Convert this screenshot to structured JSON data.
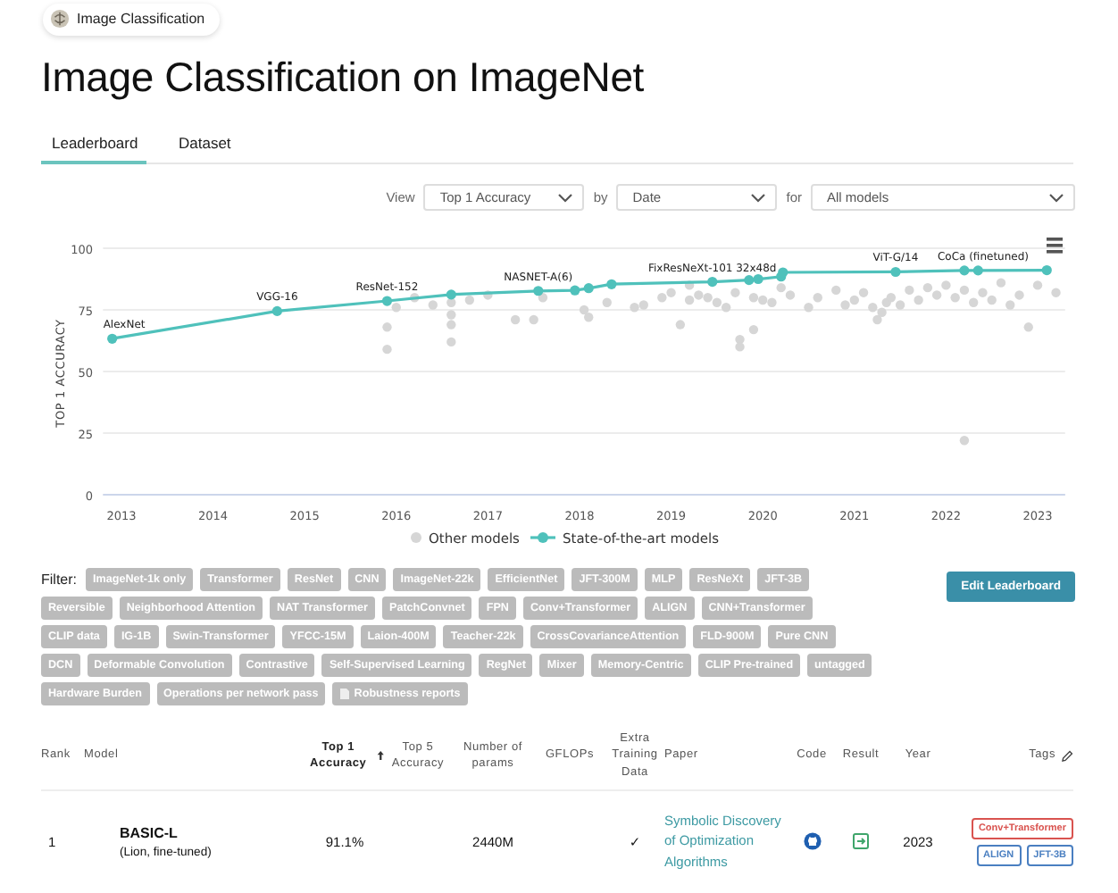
{
  "breadcrumb": {
    "label": "Image Classification"
  },
  "title": "Image Classification on ImageNet",
  "tabs": [
    {
      "label": "Leaderboard",
      "selected": true
    },
    {
      "label": "Dataset",
      "selected": false
    }
  ],
  "view_controls": [
    {
      "label": "View",
      "value": "Top 1 Accuracy"
    },
    {
      "label": "by",
      "value": "Date"
    },
    {
      "label": "for",
      "value": "All models"
    }
  ],
  "chart": {
    "chart_data": {
      "type": "line",
      "grid": true,
      "legend": true,
      "ylabel": "TOP 1 ACCURACY",
      "xlim": [
        2012.8,
        2023.3
      ],
      "ylim": [
        0,
        100
      ],
      "xticks": [
        2013,
        2014,
        2015,
        2016,
        2017,
        2018,
        2019,
        2020,
        2021,
        2022,
        2023
      ],
      "yticks": [
        0,
        25,
        50,
        75,
        100
      ],
      "series": [
        {
          "name": "Other models",
          "type": "scatter",
          "color": "#d6d6d6",
          "x": [
            2015.9,
            2015.9,
            2016.0,
            2016.2,
            2016.4,
            2016.6,
            2016.6,
            2016.6,
            2016.6,
            2016.8,
            2017.0,
            2017.3,
            2017.5,
            2017.6,
            2018.05,
            2018.1,
            2018.3,
            2018.6,
            2018.7,
            2018.9,
            2019.0,
            2019.1,
            2019.2,
            2019.3,
            2019.4,
            2019.5,
            2019.6,
            2019.7,
            2019.75,
            2019.75,
            2019.9,
            2019.9,
            2020.0,
            2020.1,
            2020.3,
            2020.5,
            2020.6,
            2020.8,
            2020.9,
            2021.0,
            2021.1,
            2021.2,
            2021.25,
            2021.3,
            2021.35,
            2021.4,
            2021.5,
            2021.6,
            2021.7,
            2021.8,
            2021.9,
            2022.0,
            2022.1,
            2022.2,
            2022.3,
            2022.4,
            2022.5,
            2022.6,
            2022.7,
            2022.8,
            2022.9,
            2023.0,
            2023.2,
            2022.2,
            2019.2,
            2020.2
          ],
          "values": [
            59,
            68,
            76,
            80,
            77,
            78,
            73,
            69,
            62,
            79,
            81,
            71,
            71,
            80,
            75,
            72,
            78,
            76,
            77,
            80,
            82,
            69,
            79,
            81,
            80,
            78,
            76,
            82,
            63,
            60,
            80,
            67,
            79,
            78,
            81,
            76,
            80,
            83,
            77,
            79,
            82,
            76,
            71,
            74,
            78,
            80,
            77,
            83,
            79,
            84,
            81,
            85,
            80,
            83,
            78,
            82,
            79,
            86,
            77,
            81,
            68,
            85,
            82,
            22,
            85,
            84
          ]
        },
        {
          "name": "State-of-the-art models",
          "type": "line",
          "marker": true,
          "color": "#4fc1bb",
          "x": [
            2012.9,
            2014.7,
            2015.9,
            2016.6,
            2017.55,
            2017.95,
            2018.1,
            2018.35,
            2019.45,
            2019.85,
            2019.95,
            2020.2,
            2020.22,
            2021.45,
            2022.2,
            2022.35,
            2023.1
          ],
          "values": [
            63.3,
            74.5,
            78.6,
            81.2,
            82.7,
            82.9,
            83.8,
            85.4,
            86.4,
            87.1,
            87.5,
            88.5,
            90.2,
            90.4,
            91.0,
            91.0,
            91.1
          ]
        }
      ],
      "annotations": [
        {
          "x": 2012.9,
          "y": 63.3,
          "text": "AlexNet"
        },
        {
          "x": 2014.7,
          "y": 74.5,
          "text": "VGG-16"
        },
        {
          "x": 2015.9,
          "y": 78.6,
          "text": "ResNet-152"
        },
        {
          "x": 2017.55,
          "y": 82.7,
          "text": "NASNET-A(6)"
        },
        {
          "x": 2019.45,
          "y": 86.4,
          "text": "FixResNeXt-101 32x48d"
        },
        {
          "x": 2021.45,
          "y": 90.4,
          "text": "ViT-G/14"
        },
        {
          "x": 2022.2,
          "y": 91.0,
          "text": "CoCa (finetuned)"
        }
      ]
    }
  },
  "filter": {
    "label": "Filter:",
    "tags": [
      {
        "label": "ImageNet-1k only",
        "kind": "tag"
      },
      {
        "label": "Transformer",
        "kind": "tag"
      },
      {
        "label": "ResNet",
        "kind": "tag"
      },
      {
        "label": "CNN",
        "kind": "tag"
      },
      {
        "label": "ImageNet-22k",
        "kind": "tag"
      },
      {
        "label": "EfficientNet",
        "kind": "tag"
      },
      {
        "label": "JFT-300M",
        "kind": "tag"
      },
      {
        "label": "MLP",
        "kind": "tag"
      },
      {
        "label": "ResNeXt",
        "kind": "tag"
      },
      {
        "label": "JFT-3B",
        "kind": "tag"
      },
      {
        "label": "Reversible",
        "kind": "tag"
      },
      {
        "label": "Neighborhood Attention",
        "kind": "tag"
      },
      {
        "label": "NAT Transformer",
        "kind": "tag"
      },
      {
        "label": "PatchConvnet",
        "kind": "tag"
      },
      {
        "label": "FPN",
        "kind": "tag"
      },
      {
        "label": "Conv+Transformer",
        "kind": "tag"
      },
      {
        "label": "ALIGN",
        "kind": "tag"
      },
      {
        "label": "CNN+Transformer",
        "kind": "tag"
      },
      {
        "label": "CLIP data",
        "kind": "tag"
      },
      {
        "label": "IG-1B",
        "kind": "tag"
      },
      {
        "label": "Swin-Transformer",
        "kind": "tag"
      },
      {
        "label": "YFCC-15M",
        "kind": "tag"
      },
      {
        "label": "Laion-400M",
        "kind": "tag"
      },
      {
        "label": "Teacher-22k",
        "kind": "tag"
      },
      {
        "label": "CrossCovarianceAttention",
        "kind": "tag"
      },
      {
        "label": "FLD-900M",
        "kind": "tag"
      },
      {
        "label": "Pure CNN",
        "kind": "tag"
      },
      {
        "label": "DCN",
        "kind": "tag"
      },
      {
        "label": "Deformable Convolution",
        "kind": "tag"
      },
      {
        "label": "Contrastive",
        "kind": "tag"
      },
      {
        "label": "Self-Supervised Learning",
        "kind": "tag"
      },
      {
        "label": "RegNet",
        "kind": "tag"
      },
      {
        "label": "Mixer",
        "kind": "tag"
      },
      {
        "label": "Memory-Centric",
        "kind": "tag"
      },
      {
        "label": "CLIP Pre-trained",
        "kind": "tag"
      },
      {
        "label": "untagged",
        "kind": "tag"
      },
      {
        "label": "Hardware Burden",
        "kind": "tag"
      },
      {
        "label": "Operations per network pass",
        "kind": "tag"
      },
      {
        "label": "Robustness reports",
        "kind": "report"
      }
    ]
  },
  "edit_button": "Edit Leaderboard",
  "table": {
    "columns": [
      {
        "label": "Rank",
        "sorted": false
      },
      {
        "label": "Model",
        "sorted": false
      },
      {
        "label": "Top 1 Accuracy",
        "sorted": true
      },
      {
        "label": "Top 5 Accuracy",
        "sorted": false
      },
      {
        "label": "Number of params",
        "sorted": false
      },
      {
        "label": "GFLOPs",
        "sorted": false
      },
      {
        "label": "Extra Training Data",
        "sorted": false
      },
      {
        "label": "Paper",
        "sorted": false
      },
      {
        "label": "Code",
        "sorted": false
      },
      {
        "label": "Result",
        "sorted": false
      },
      {
        "label": "Year",
        "sorted": false
      },
      {
        "label": "Tags",
        "sorted": false
      }
    ],
    "rows": [
      {
        "rank": "1",
        "model": "BASIC-L",
        "model_note": "(Lion, fine-tuned)",
        "top1": "91.1%",
        "params": "2440M",
        "extra_data": "✓",
        "paper": "Symbolic Discovery of Optimization Algorithms",
        "year": "2023",
        "tags": [
          {
            "label": "Conv+Transformer",
            "color": "#d9534f"
          },
          {
            "label": "ALIGN",
            "color": "#4a7fc1"
          },
          {
            "label": "JFT-3B",
            "color": "#4a7fc1"
          }
        ]
      }
    ]
  }
}
